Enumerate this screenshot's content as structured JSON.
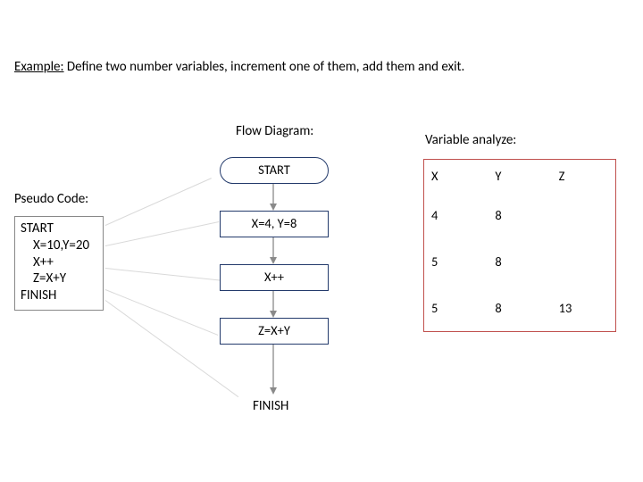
{
  "title_prefix": "Example:",
  "title_rest": " Define two number variables, increment one of them, add them and exit.",
  "headings": {
    "flow": "Flow Diagram:",
    "variables": "Variable analyze:",
    "pseudo": "Pseudo Code:"
  },
  "pseudo": {
    "l1": "START",
    "l2": "X=10,Y=20",
    "l3": "X++",
    "l4": "Z=X+Y",
    "l5": "FINISH"
  },
  "flow": {
    "start": "START",
    "assign": "X=4, Y=8",
    "inc": "X++",
    "sum": "Z=X+Y",
    "finish": "FINISH"
  },
  "table": {
    "h_x": "X",
    "h_y": "Y",
    "h_z": "Z",
    "r1_x": "4",
    "r1_y": "8",
    "r1_z": "",
    "r2_x": "5",
    "r2_y": "8",
    "r2_z": "",
    "r3_x": "5",
    "r3_y": "8",
    "r3_z": "13"
  },
  "chart_data": {
    "type": "table",
    "title": "Variable analyze",
    "columns": [
      "X",
      "Y",
      "Z"
    ],
    "rows": [
      {
        "step": "X=4, Y=8",
        "X": 4,
        "Y": 8,
        "Z": null
      },
      {
        "step": "X++",
        "X": 5,
        "Y": 8,
        "Z": null
      },
      {
        "step": "Z=X+Y",
        "X": 5,
        "Y": 8,
        "Z": 13
      }
    ],
    "flow_sequence": [
      "START",
      "X=4, Y=8",
      "X++",
      "Z=X+Y",
      "FINISH"
    ]
  }
}
